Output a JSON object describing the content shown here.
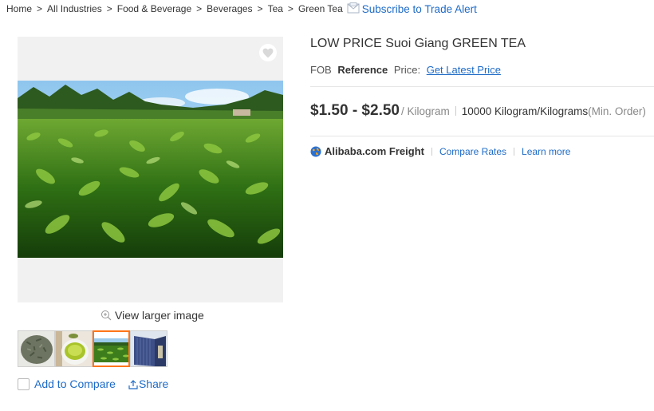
{
  "breadcrumb": {
    "items": [
      "Home",
      "All Industries",
      "Food & Beverage",
      "Beverages",
      "Tea",
      "Green Tea"
    ],
    "separator": ">",
    "subscribe": "Subscribe to Trade Alert"
  },
  "gallery": {
    "view_larger": "View larger image",
    "thumbnails": [
      "loose green tea leaves",
      "green tea in cup",
      "tea plantation",
      "shipping container"
    ],
    "active_thumbnail": 2
  },
  "actions": {
    "compare": "Add to Compare",
    "share": "Share"
  },
  "product": {
    "title": "LOW PRICE Suoi Giang GREEN TEA",
    "fob": "FOB",
    "reference": "Reference",
    "price_label": "Price:",
    "latest_price": "Get Latest Price",
    "price": "$1.50 - $2.50",
    "unit": "/ Kilogram",
    "moq": "10000 Kilogram/Kilograms",
    "moq_note": "(Min. Order)"
  },
  "freight": {
    "name": "Alibaba.com Freight",
    "compare": "Compare Rates",
    "learn": "Learn more"
  },
  "colors": {
    "link": "#1e6bc7",
    "active_border": "#ff7519",
    "text": "#333333",
    "muted": "#888888"
  }
}
